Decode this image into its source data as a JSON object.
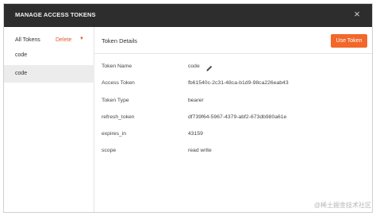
{
  "dialog": {
    "title": "MANAGE ACCESS TOKENS",
    "close_icon": "×"
  },
  "sidebar": {
    "header_label": "All Tokens",
    "delete_label": "Delete",
    "delete_caret": "▼",
    "items": [
      {
        "label": "code"
      },
      {
        "label": "code"
      }
    ]
  },
  "main": {
    "title": "Token Details",
    "use_token_label": "Use Token",
    "fields": [
      {
        "label": "Token Name",
        "value": "code"
      },
      {
        "label": "Access Token",
        "value": "fb61540c-2c31-48ca-b1d9-98ca226eab43"
      },
      {
        "label": "Token Type",
        "value": "bearer"
      },
      {
        "label": "refresh_token",
        "value": "df739f64-5967-4379-abf2-673db980a61e"
      },
      {
        "label": "expires_in",
        "value": "43159"
      },
      {
        "label": "scope",
        "value": "read write"
      }
    ]
  },
  "watermark": "@稀土掘金技术社区",
  "colors": {
    "titlebar": "#2d2d2d",
    "accent": "#f2682a",
    "delete": "#e05a2b",
    "selected_row": "#ececec"
  },
  "icons": {
    "close": "close-icon",
    "pencil": "pencil-icon",
    "caret": "caret-down-icon"
  }
}
